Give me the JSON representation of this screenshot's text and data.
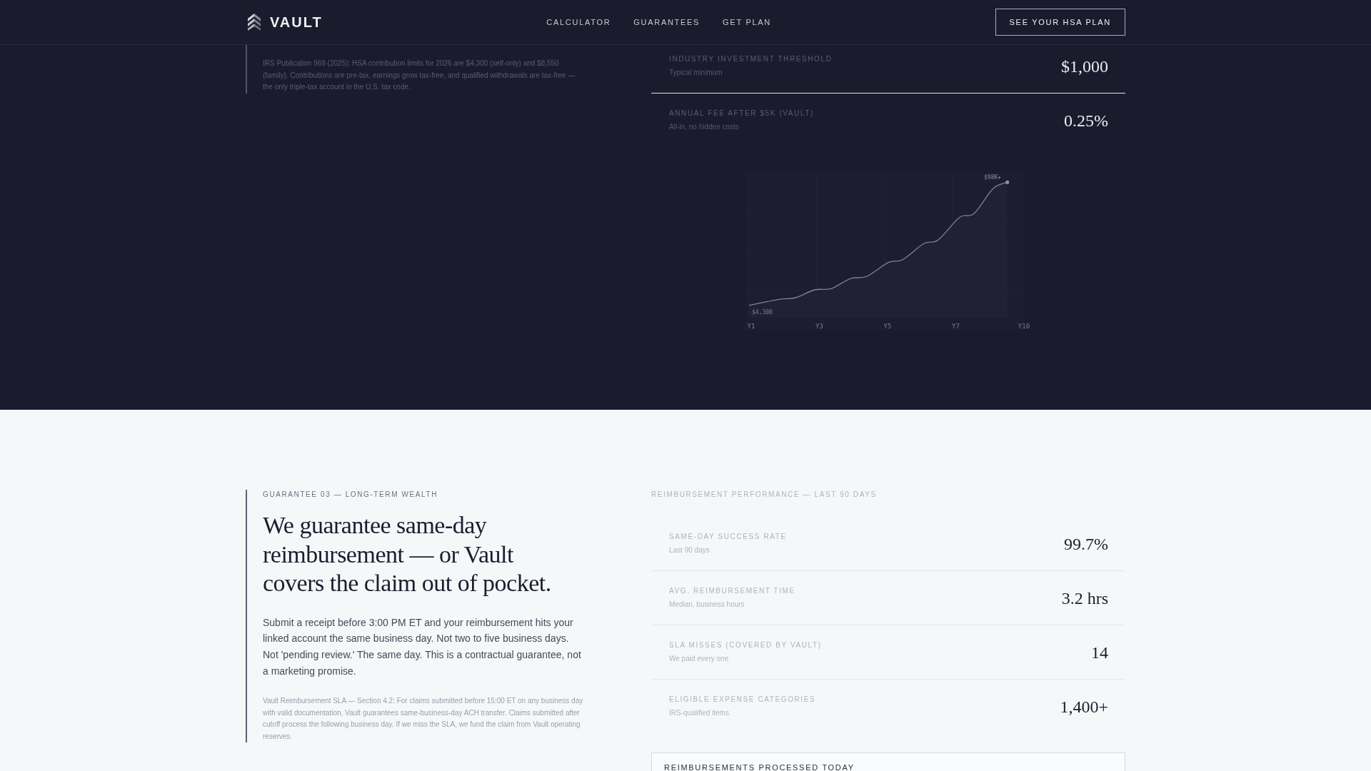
{
  "header": {
    "brand": "VAULT",
    "nav": [
      "CALCULATOR",
      "GUARANTEES",
      "GET PLAN"
    ],
    "cta": "SEE YOUR HSA PLAN"
  },
  "hsa_section": {
    "note": "IRS Publication 969 (2025): HSA contribution limits for 2026 are $4,300 (self-only) and $8,550 (family). Contributions are pre-tax, earnings grow tax-free, and qualified withdrawals are tax-free — the only triple-tax account in the U.S. tax code.",
    "metrics": [
      {
        "label": "INDUSTRY INVESTMENT THRESHOLD",
        "sub": "Typical minimum",
        "value": "$1,000"
      },
      {
        "label": "ANNUAL FEE AFTER $5K (VAULT)",
        "sub": "All-in, no hidden costs",
        "value": "0.25%"
      }
    ],
    "growth_chart": {
      "start_label": "$4,300",
      "end_label": "$98K+",
      "x_labels": [
        "Y1",
        "Y3",
        "Y5",
        "Y7",
        "Y10"
      ]
    }
  },
  "guarantee_section": {
    "eyebrow": "GUARANTEE 03 — LONG-TERM WEALTH",
    "heading": "We guarantee same-day reimbursement — or Vault covers the claim out of pocket.",
    "body": "Submit a receipt before 3:00 PM ET and your reimbursement hits your linked account the same business day. Not two to five business days. Not 'pending review.' The same day. This is a contractual guarantee, not a marketing promise.",
    "fine_print": "Vault Reimbursement SLA — Section 4.2: For claims submitted before 15:00 ET on any business day with valid documentation, Vault guarantees same-business-day ACH transfer. Claims submitted after cutoff process the following business day. If we miss the SLA, we fund the claim from Vault operating reserves.",
    "performance": {
      "title": "REIMBURSEMENT PERFORMANCE — LAST 90 DAYS",
      "metrics": [
        {
          "label": "SAME-DAY SUCCESS RATE",
          "sub": "Last 90 days",
          "value": "99.7%"
        },
        {
          "label": "AVG. REIMBURSEMENT TIME",
          "sub": "Median, business hours",
          "value": "3.2 hrs"
        },
        {
          "label": "SLA MISSES (COVERED BY VAULT)",
          "sub": "We paid every one",
          "value": "14"
        },
        {
          "label": "ELIGIBLE EXPENSE CATEGORIES",
          "sub": "IRS-qualified items",
          "value": "1,400+"
        }
      ],
      "processed_today": {
        "title": "REIMBURSEMENTS PROCESSED TODAY"
      }
    }
  }
}
